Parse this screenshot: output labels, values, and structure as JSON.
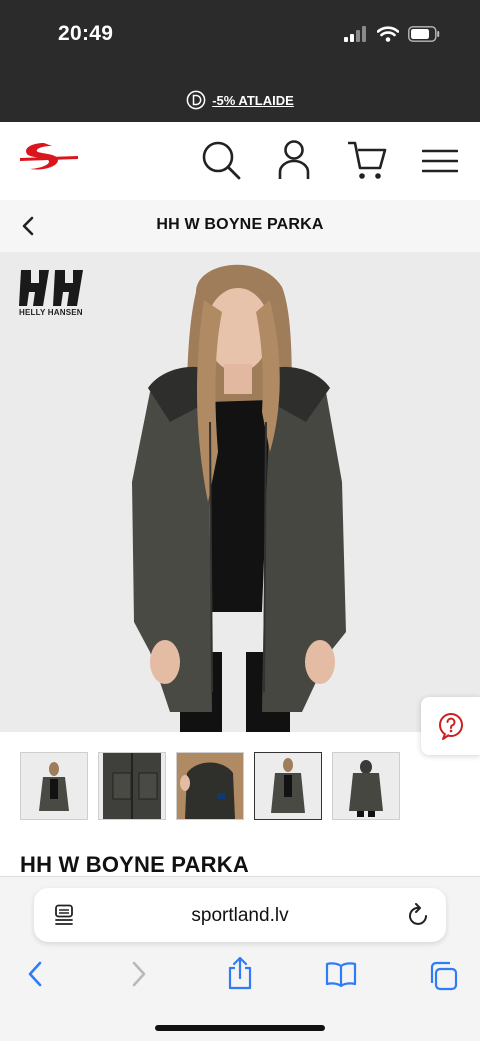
{
  "status": {
    "time": "20:49"
  },
  "promo": {
    "text": "-5% ATLAIDE",
    "icon": "discount-circle-icon"
  },
  "header": {
    "icons": [
      "sportland-logo",
      "search-icon",
      "account-icon",
      "cart-icon",
      "menu-icon"
    ]
  },
  "title_bar": {
    "title": "HH W BOYNE PARKA"
  },
  "product": {
    "brand_logo_text": "HELLY HANSEN",
    "name": "HH W BOYNE PARKA",
    "thumbnails": [
      "front",
      "detail-pocket",
      "detail-hood",
      "front-zoom",
      "back"
    ],
    "active_thumbnail": 4
  },
  "browser": {
    "url": "sportland.lv"
  },
  "colors": {
    "dark_bar": "#2b2b2b",
    "brand_red": "#d9161c",
    "safari_blue": "#2f7cf6",
    "help_red": "#cc1f1f"
  }
}
